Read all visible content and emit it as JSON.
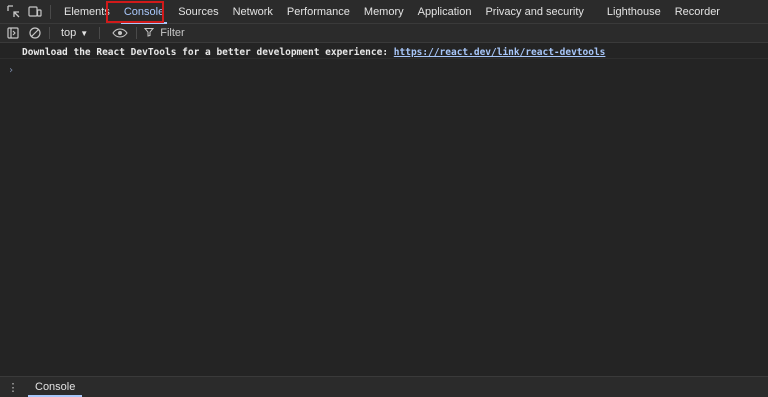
{
  "tabs": [
    {
      "label": "Elements"
    },
    {
      "label": "Console",
      "active": true
    },
    {
      "label": "Sources"
    },
    {
      "label": "Network"
    },
    {
      "label": "Performance"
    },
    {
      "label": "Memory"
    },
    {
      "label": "Application"
    },
    {
      "label": "Privacy and security"
    },
    {
      "label": "Lighthouse"
    },
    {
      "label": "Recorder"
    }
  ],
  "toolbar": {
    "context": "top",
    "filter_label": "Filter"
  },
  "console": {
    "message_text": "Download the React DevTools for a better development experience: ",
    "message_link": "https://react.dev/link/react-devtools",
    "prompt": "›"
  },
  "drawer": {
    "tab_label": "Console"
  },
  "colors": {
    "accent": "#a8c7fa",
    "highlight_box": "#d11a1a",
    "background": "#242424"
  }
}
